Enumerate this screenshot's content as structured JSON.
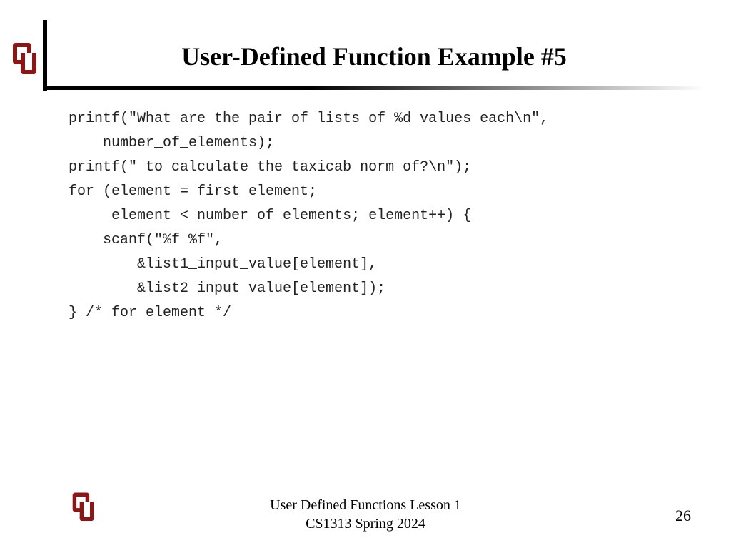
{
  "title": "User-Defined Function Example #5",
  "code_lines": [
    "printf(\"What are the pair of lists of %d values each\\n\",",
    "    number_of_elements);",
    "printf(\" to calculate the taxicab norm of?\\n\");",
    "for (element = first_element;",
    "     element < number_of_elements; element++) {",
    "    scanf(\"%f %f\",",
    "        &list1_input_value[element],",
    "        &list2_input_value[element]);",
    "} /* for element */"
  ],
  "footer_line1": "User Defined Functions Lesson 1",
  "footer_line2": "CS1313 Spring 2024",
  "page_number": "26",
  "brand_color": "#8c1515"
}
